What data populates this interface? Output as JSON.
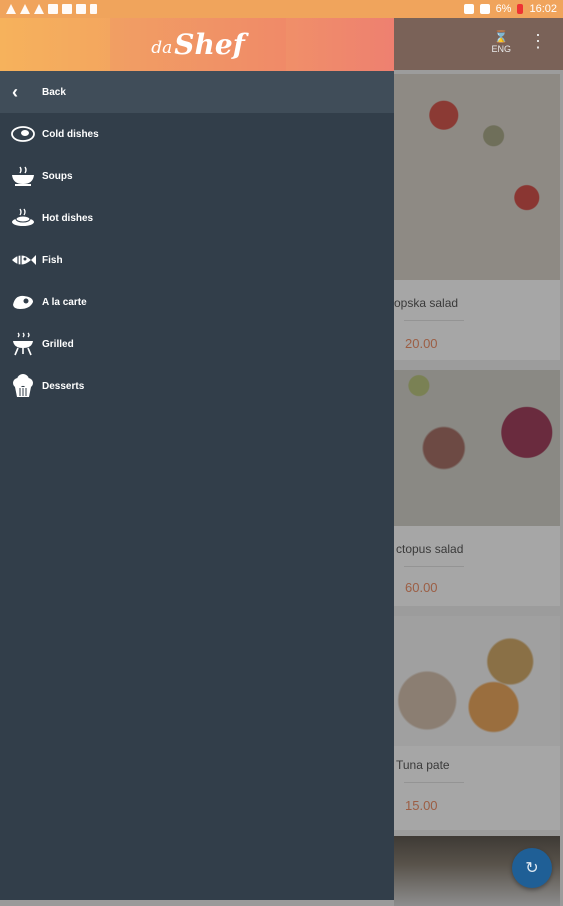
{
  "status_bar": {
    "battery": "6%",
    "time": "16:02"
  },
  "header": {
    "logo_prefix": "da",
    "logo_main": "Shef",
    "language": "ENG"
  },
  "drawer": {
    "back_label": "Back",
    "items": [
      {
        "label": "Cold dishes",
        "icon": "plate-icon"
      },
      {
        "label": "Soups",
        "icon": "soup-icon"
      },
      {
        "label": "Hot dishes",
        "icon": "hot-dish-icon"
      },
      {
        "label": "Fish",
        "icon": "fish-icon"
      },
      {
        "label": "A la carte",
        "icon": "steak-icon"
      },
      {
        "label": "Grilled",
        "icon": "grill-icon"
      },
      {
        "label": "Desserts",
        "icon": "cupcake-icon"
      }
    ]
  },
  "products": [
    {
      "name": "opska salad",
      "price": "20.00"
    },
    {
      "name": "ctopus salad",
      "price": "60.00"
    },
    {
      "name": "Tuna pate",
      "price": "15.00"
    }
  ],
  "colors": {
    "drawer_bg": "#323e4a",
    "back_row_bg": "#404d59",
    "fab": "#1f5f96"
  }
}
